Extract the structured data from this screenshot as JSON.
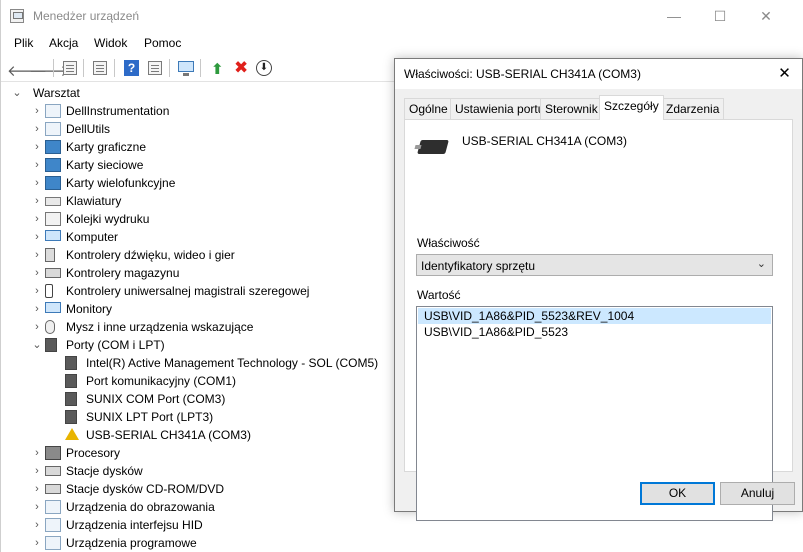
{
  "window": {
    "title": "Menedżer urządzeń",
    "controls": {
      "minimize": "—",
      "maximize": "☐",
      "close": "✕"
    }
  },
  "menu": [
    "Plik",
    "Akcja",
    "Widok",
    "Pomoc"
  ],
  "toolbar": {
    "icons": [
      "back-icon",
      "forward-icon",
      "properties-sheet-icon",
      "device-sheet-icon",
      "help-icon",
      "properties-icon",
      "scan-monitor-icon",
      "update-driver-icon",
      "uninstall-icon",
      "download-icon"
    ],
    "back": "🡐",
    "forward": "🡒",
    "help": "?",
    "update": "⬆",
    "remove": "✖",
    "down": "⬇"
  },
  "tree": {
    "root": "Warsztat",
    "expanded_arrow": "⌄",
    "collapsed_arrow": "›",
    "items": [
      {
        "label": "DellInstrumentation",
        "icon": "generic"
      },
      {
        "label": "DellUtils",
        "icon": "generic"
      },
      {
        "label": "Karty graficzne",
        "icon": "display"
      },
      {
        "label": "Karty sieciowe",
        "icon": "display"
      },
      {
        "label": "Karty wielofunkcyjne",
        "icon": "display"
      },
      {
        "label": "Klawiatury",
        "icon": "keyboard"
      },
      {
        "label": "Kolejki wydruku",
        "icon": "printer"
      },
      {
        "label": "Komputer",
        "icon": "monitor"
      },
      {
        "label": "Kontrolery dźwięku, wideo i gier",
        "icon": "speaker"
      },
      {
        "label": "Kontrolery magazynu",
        "icon": "disk"
      },
      {
        "label": "Kontrolery uniwersalnej magistrali szeregowej",
        "icon": "usb"
      },
      {
        "label": "Monitory",
        "icon": "monitor"
      },
      {
        "label": "Mysz i inne urządzenia wskazujące",
        "icon": "mouse"
      },
      {
        "label": "Porty (COM i LPT)",
        "icon": "port",
        "expanded": true,
        "children": [
          {
            "label": "Intel(R) Active Management Technology - SOL (COM5)",
            "icon": "port"
          },
          {
            "label": "Port komunikacyjny (COM1)",
            "icon": "port"
          },
          {
            "label": "SUNIX COM Port (COM3)",
            "icon": "port"
          },
          {
            "label": "SUNIX LPT Port (LPT3)",
            "icon": "port"
          },
          {
            "label": "USB-SERIAL CH341A (COM3)",
            "icon": "warning"
          }
        ]
      },
      {
        "label": "Procesory",
        "icon": "cpu"
      },
      {
        "label": "Stacje dysków",
        "icon": "disk"
      },
      {
        "label": "Stacje dysków CD-ROM/DVD",
        "icon": "disk"
      },
      {
        "label": "Urządzenia do obrazowania",
        "icon": "generic"
      },
      {
        "label": "Urządzenia interfejsu HID",
        "icon": "generic"
      },
      {
        "label": "Urządzenia programowe",
        "icon": "generic"
      }
    ]
  },
  "dialog": {
    "title": "Właściwości: USB-SERIAL CH341A (COM3)",
    "close": "✕",
    "tabs": [
      {
        "label": "Ogólne"
      },
      {
        "label": "Ustawienia portu"
      },
      {
        "label": "Sterownik"
      },
      {
        "label": "Szczegóły",
        "active": true
      },
      {
        "label": "Zdarzenia"
      }
    ],
    "device_name": "USB-SERIAL CH341A (COM3)",
    "property_label": "Właściwość",
    "property_value": "Identyfikatory sprzętu",
    "select_chevron": "⌄",
    "value_label": "Wartość",
    "values": [
      {
        "text": "USB\\VID_1A86&PID_5523&REV_1004",
        "selected": true
      },
      {
        "text": "USB\\VID_1A86&PID_5523",
        "selected": false
      }
    ],
    "ok": "OK",
    "cancel": "Anuluj"
  },
  "colors": {
    "selection": "#cce8ff",
    "accent": "#0078d7",
    "warning": "#e8b400"
  }
}
